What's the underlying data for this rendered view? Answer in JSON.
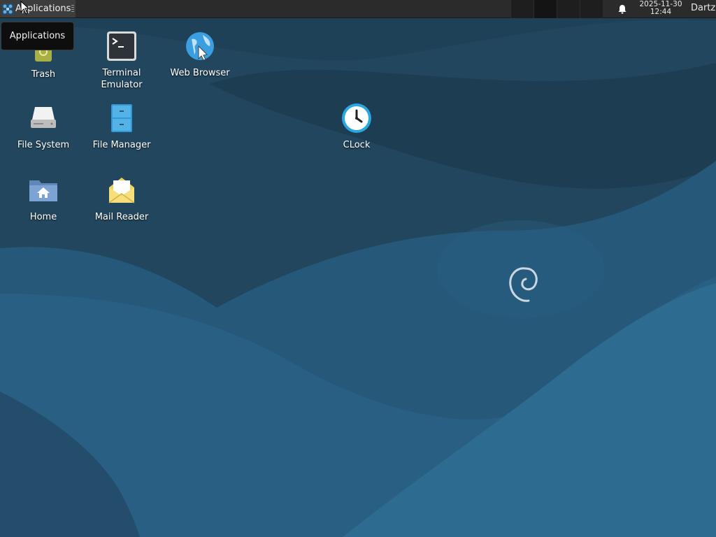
{
  "panel": {
    "app_menu_label": "Applications",
    "notification_icon": "bell-icon",
    "clock": {
      "date": "2025-11-30",
      "time": "12:44"
    },
    "user": "Dartz"
  },
  "tooltip": {
    "text": "Applications"
  },
  "desktop": {
    "icons": [
      {
        "label": "Trash",
        "icon": "trash-icon"
      },
      {
        "label": "Terminal Emulator",
        "icon": "terminal-icon"
      },
      {
        "label": "Web Browser",
        "icon": "web-browser-icon"
      },
      {
        "label": "File System",
        "icon": "drive-icon"
      },
      {
        "label": "File Manager",
        "icon": "file-manager-icon"
      },
      {
        "label": "CLock",
        "icon": "clock-icon"
      },
      {
        "label": "Home",
        "icon": "home-folder-icon"
      },
      {
        "label": "Mail Reader",
        "icon": "mail-icon"
      }
    ]
  },
  "colors": {
    "wallpaper_base": "#244a63",
    "wave_light": "#2e6a8e",
    "panel_bg": "#2b2b2b",
    "accent": "#3daee9"
  }
}
